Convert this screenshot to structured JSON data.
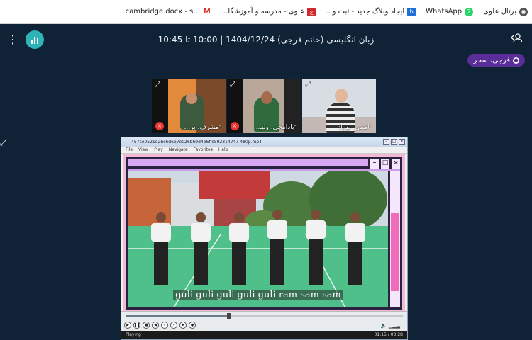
{
  "bookmarks": [
    {
      "label": "برتال علوی",
      "icon": "globe-icon"
    },
    {
      "label": "WhatsApp",
      "badge": "2",
      "icon": "whatsapp-icon"
    },
    {
      "label": "ایجاد وبلاگ جدید - ثبت و...",
      "icon": "blog-icon"
    },
    {
      "label": "علوی - مدرسه و آموزشگا...",
      "icon": "school-icon"
    },
    {
      "label": "cambridge.docx - s...",
      "icon": "gmail-icon"
    }
  ],
  "header": {
    "title": "زبان انگلیسی (خانم فرجی) 1404/12/24 | 10:00 تا 10:45",
    "menu_icon": "⋮",
    "user_icon": "person-icon"
  },
  "presenter_pill": "فرجی، سحر",
  "participants": [
    {
      "name": "مشرف، بر...",
      "mic_off": true
    },
    {
      "name": "بادامچی، ولیـ...",
      "mic_off": true
    },
    {
      "name": "امینی، بهراد",
      "mic_off": false
    }
  ],
  "player": {
    "window_title": "457ce0521d2bc6d6b7e026b69d4b6ffc592314747-480p.mp4",
    "menu": [
      "File",
      "View",
      "Play",
      "Navigate",
      "Favorites",
      "Help"
    ],
    "caption": "guli guli guli guli guli ram sam sam",
    "status": "Playing",
    "time": "01:15 / 03:28",
    "progress": 0.37
  }
}
